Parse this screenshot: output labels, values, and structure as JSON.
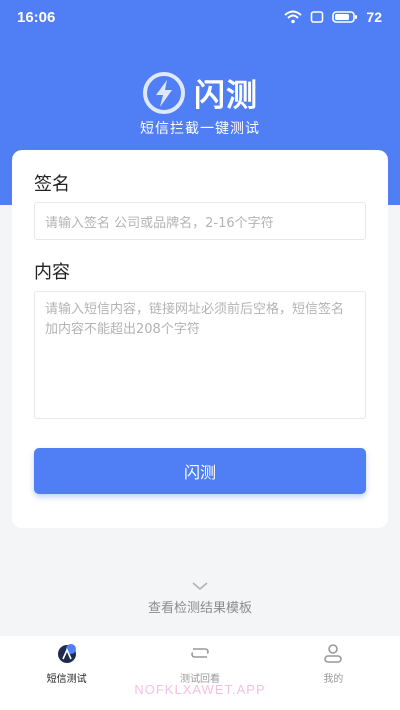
{
  "status_bar": {
    "time": "16:06",
    "battery": "72",
    "icons": [
      "wifi-icon",
      "sim-icon",
      "battery-icon"
    ]
  },
  "brand": {
    "name": "闪测",
    "subtitle": "短信拦截一键测试",
    "icon": "lightning-bolt-icon"
  },
  "form": {
    "signature_label": "签名",
    "signature_placeholder": "请输入签名 公司或品牌名，2-16个字符",
    "signature_value": "",
    "content_label": "内容",
    "content_placeholder": "请输入短信内容，链接网址必须前后空格，短信签名加内容不能超出208个字符",
    "content_value": "",
    "submit_label": "闪测"
  },
  "template_link": {
    "label": "查看检测结果模板",
    "icon": "chevron-down-icon"
  },
  "tabbar": {
    "tabs": [
      {
        "label": "短信测试",
        "icon": "sms-test-icon",
        "active": true
      },
      {
        "label": "测试回看",
        "icon": "history-icon",
        "active": false
      },
      {
        "label": "我的",
        "icon": "profile-icon",
        "active": false
      }
    ]
  },
  "watermark": "NOFKLXAWET.APP",
  "colors": {
    "primary": "#4f7ef5",
    "background": "#f4f5f7",
    "watermark": "#f3c1e3"
  }
}
